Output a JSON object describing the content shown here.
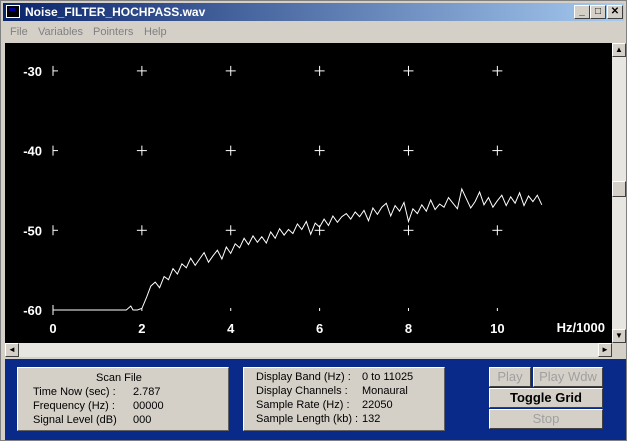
{
  "window": {
    "title": "Noise_FILTER_HOCHPASS.wav"
  },
  "title_buttons": {
    "minimize": "_",
    "maximize": "□",
    "close": "✕"
  },
  "menu": {
    "items": [
      "File",
      "Variables",
      "Pointers",
      "Help"
    ]
  },
  "chart_data": {
    "type": "line",
    "xlabel": "Hz/1000",
    "ylabel": "",
    "x_ticks": [
      "0",
      "2",
      "4",
      "6",
      "8",
      "10"
    ],
    "y_ticks": [
      "-30",
      "-40",
      "-50",
      "-60"
    ],
    "xlim": [
      0,
      11.5
    ],
    "ylim": [
      -60,
      -26.5
    ],
    "grid": true,
    "series": [
      {
        "color": "#ffffff",
        "x": [
          0,
          0.5,
          1,
          1.5,
          1.65,
          1.75,
          1.8,
          1.9,
          2.0,
          2.1,
          2.2,
          2.3,
          2.4,
          2.5,
          2.6,
          2.7,
          2.8,
          2.9,
          3.0,
          3.1,
          3.2,
          3.3,
          3.4,
          3.5,
          3.6,
          3.7,
          3.8,
          3.9,
          4.0,
          4.1,
          4.2,
          4.3,
          4.4,
          4.5,
          4.6,
          4.7,
          4.8,
          4.9,
          5.0,
          5.1,
          5.2,
          5.3,
          5.4,
          5.5,
          5.6,
          5.7,
          5.8,
          5.9,
          6.0,
          6.1,
          6.2,
          6.3,
          6.4,
          6.5,
          6.6,
          6.7,
          6.8,
          6.9,
          7.0,
          7.1,
          7.2,
          7.3,
          7.4,
          7.5,
          7.6,
          7.7,
          7.8,
          7.9,
          8.0,
          8.1,
          8.2,
          8.3,
          8.4,
          8.5,
          8.6,
          8.7,
          8.8,
          8.9,
          9.0,
          9.1,
          9.2,
          9.3,
          9.4,
          9.5,
          9.6,
          9.7,
          9.8,
          9.9,
          10.0,
          10.1,
          10.2,
          10.3,
          10.4,
          10.5,
          10.6,
          10.7,
          10.8,
          10.9,
          11.0
        ],
        "y": [
          -60,
          -60,
          -60,
          -60,
          -60,
          -59.5,
          -60,
          -60,
          -59.8,
          -58.5,
          -57,
          -56.5,
          -57.2,
          -55.8,
          -56.2,
          -54.8,
          -55.5,
          -54.2,
          -54.7,
          -53.5,
          -54.4,
          -53.6,
          -52.8,
          -54,
          -53.2,
          -52.5,
          -53.6,
          -52.1,
          -52.9,
          -51.7,
          -52.2,
          -51,
          -51.8,
          -50.7,
          -51.5,
          -50.8,
          -51.6,
          -50.2,
          -51,
          -49.8,
          -50.6,
          -49.9,
          -50.4,
          -49.2,
          -49.9,
          -48.9,
          -50.5,
          -49.1,
          -49.6,
          -48.6,
          -49.4,
          -48.2,
          -49,
          -48.3,
          -47.9,
          -48.6,
          -47.7,
          -48.3,
          -47.5,
          -48.8,
          -47.2,
          -48,
          -47.1,
          -46.6,
          -48.2,
          -46.9,
          -47.6,
          -46.5,
          -48.9,
          -47.3,
          -47.9,
          -46.8,
          -47.6,
          -46.2,
          -47.4,
          -46.7,
          -47.1,
          -45.9,
          -46.6,
          -47.3,
          -44.8,
          -46,
          -47.2,
          -46.4,
          -45.2,
          -46.8,
          -45.9,
          -47.1,
          -46.3,
          -45.6,
          -46.9,
          -45.8,
          -46.6,
          -45.3,
          -46.9,
          -45.7,
          -46.4,
          -45.6,
          -46.8
        ]
      }
    ]
  },
  "scan_panel": {
    "heading": "Scan File",
    "rows": [
      {
        "label": "Time Now (sec) :",
        "value": "2.787"
      },
      {
        "label": "Frequency (Hz) :",
        "value": "00000"
      },
      {
        "label": "Signal Level (dB)",
        "value": "000"
      }
    ]
  },
  "info_panel": {
    "rows": [
      {
        "label": "Display Band (Hz) :",
        "value": "0 to 11025"
      },
      {
        "label": "Display Channels :",
        "value": "Monaural"
      },
      {
        "label": "Sample Rate (Hz) :",
        "value": "22050"
      },
      {
        "label": "Sample Length (kb) :",
        "value": "132"
      }
    ]
  },
  "buttons": {
    "play": "Play",
    "play_window": "Play Wdw",
    "toggle_grid": "Toggle Grid",
    "stop": "Stop"
  },
  "scroll_arrows": {
    "up": "▲",
    "down": "▼",
    "left": "◄",
    "right": "►"
  }
}
